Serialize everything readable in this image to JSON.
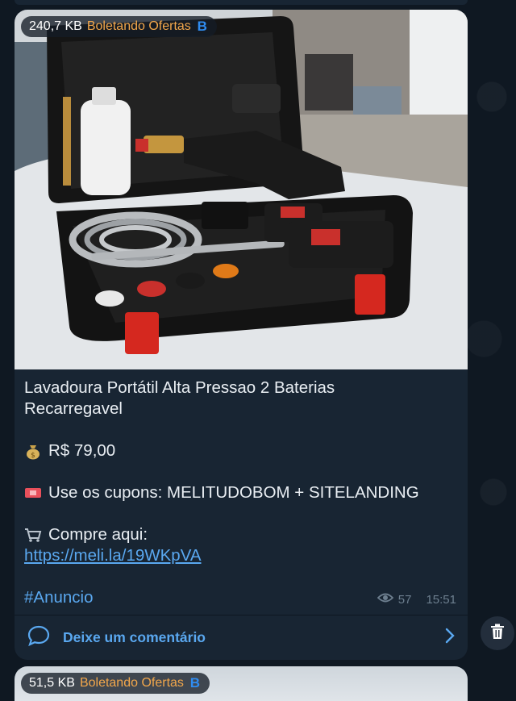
{
  "message": {
    "file_size": "240,7 KB",
    "channel": "Boletando Ofertas",
    "channel_badge": "B",
    "title_line1": "Lavadoura Portátil Alta Pressao 2 Baterias",
    "title_line2": "Recarregavel",
    "price": "R$ 79,00",
    "coupon": "Use os cupons: MELITUDOBOM + SITELANDING",
    "buy_label": "Compre aqui:",
    "buy_link": "https://meli.la/19WKpVA",
    "hashtag": "#Anuncio",
    "views": "57",
    "time": "15:51",
    "comment_label": "Deixe um comentário",
    "emoji": {
      "price": "money-bag-icon",
      "coupon": "ticket-icon",
      "buy": "shopping-cart-icon"
    }
  },
  "next_message": {
    "file_size": "51,5 KB",
    "channel": "Boletando Ofertas",
    "channel_badge": "B"
  },
  "colors": {
    "background": "#0e1621",
    "bubble": "#182533",
    "link": "#5aa8f0",
    "channel_name": "#f2a74b",
    "meta": "#6d7f8f"
  }
}
